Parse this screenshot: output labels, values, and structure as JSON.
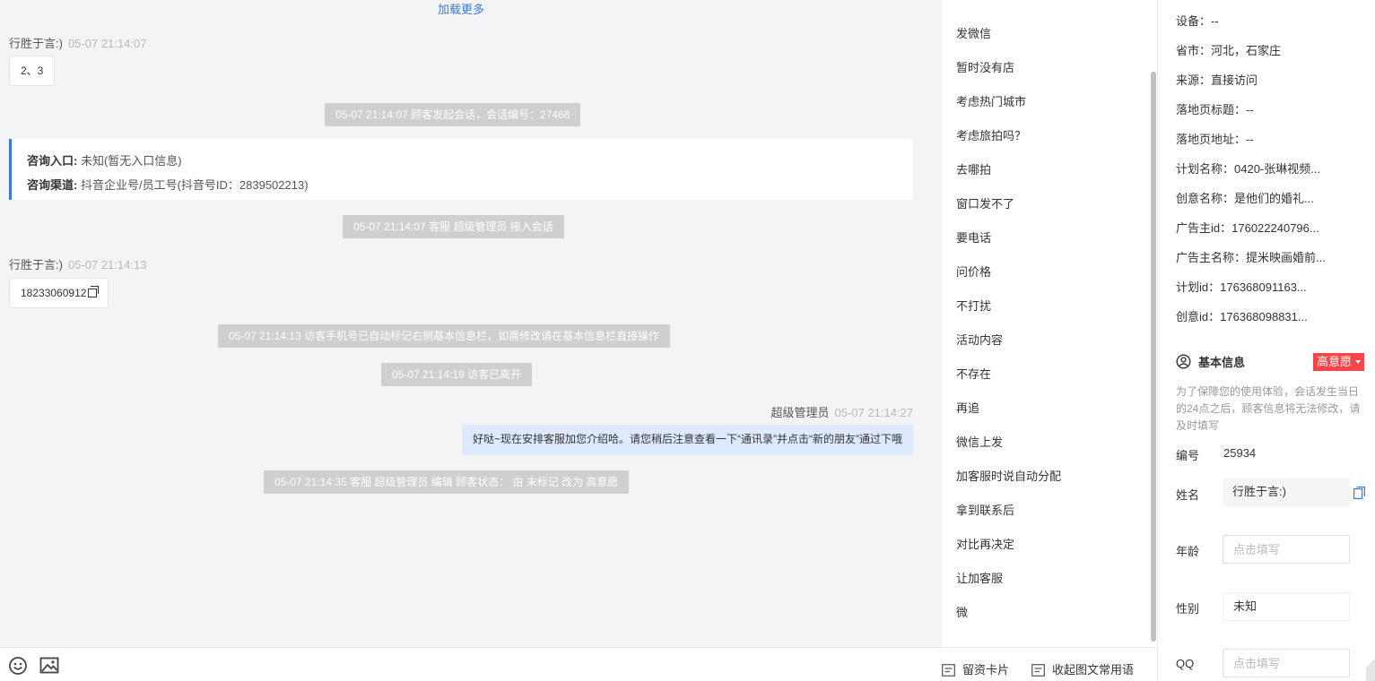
{
  "chat": {
    "load_more": "加载更多",
    "messages": [
      {
        "sender": "行胜于言:)",
        "time": "05-07 21:14:07",
        "text": "2、3"
      },
      {
        "system": "05-07 21:14:07 顾客发起会话，会话编号：27468"
      },
      {
        "consult_entry_label": "咨询入口:",
        "consult_entry_value": "未知(暂无入口信息)",
        "consult_channel_label": "咨询渠道:",
        "consult_channel_value": "抖音企业号/员工号(抖音号ID：2839502213)"
      },
      {
        "system": "05-07 21:14:07 客服 超级管理员 接入会话"
      },
      {
        "sender": "行胜于言:)",
        "time": "05-07 21:14:13",
        "text": "18233060912"
      },
      {
        "system": "05-07 21:14:13 访客手机号已自动标记右侧基本信息栏，如需修改请在基本信息栏直接操作"
      },
      {
        "system": "05-07 21:14:19 访客已离开"
      },
      {
        "sender": "超级管理员",
        "time": "05-07 21:14:27",
        "text": "好哒~现在安排客服加您介绍哈。请您稍后注意查看一下“通讯录”并点击“新的朋友”通过下哦"
      },
      {
        "system": "05-07 21:14:35 客服 超级管理员 编辑 顾客状态： 由 未标记 改为 高意愿"
      }
    ]
  },
  "quick_replies": {
    "items": [
      "发微信",
      "暂时没有店",
      "考虑热门城市",
      "考虑旅拍吗？",
      "去哪拍",
      "窗口发不了",
      "要电话",
      "问价格",
      "不打扰",
      "活动内容",
      "不存在",
      "再追",
      "微信上发",
      "加客服时说自动分配",
      "拿到联系后",
      "对比再决定",
      "让加客服",
      "微"
    ]
  },
  "bottom_bar": {
    "emoji_icon": "smile-icon",
    "image_icon": "image-icon",
    "card_label": "留资卡片",
    "collapse_label": "收起图文常用语"
  },
  "info_panel": {
    "visitor_meta": [
      {
        "label": "设备：",
        "value": "--"
      },
      {
        "label": "省市：",
        "value": "河北，石家庄"
      },
      {
        "label": "来源：",
        "value": "直接访问"
      },
      {
        "label": "落地页标题：",
        "value": "--"
      },
      {
        "label": "落地页地址：",
        "value": "--"
      },
      {
        "label": "计划名称：",
        "value": "0420-张琳视频..."
      },
      {
        "label": "创意名称：",
        "value": "是他们的婚礼..."
      },
      {
        "label": "广告主id：",
        "value": "176022240796..."
      },
      {
        "label": "广告主名称：",
        "value": "提米映画婚前..."
      },
      {
        "label": "计划id：",
        "value": "176368091163..."
      },
      {
        "label": "创意id：",
        "value": "176368098831..."
      }
    ],
    "basic_info_title": "基本信息",
    "intent_badge": "高意愿",
    "intent_color": "#f5454b",
    "notice": "为了保障您的使用体验，会话发生当日的24点之后，顾客信息将无法修改，请及时填写",
    "fields": {
      "id_label": "编号",
      "id_value": "25934",
      "name_label": "姓名",
      "name_value": "行胜于言:)",
      "age_label": "年龄",
      "age_placeholder": "点击填写",
      "gender_label": "性别",
      "gender_value": "未知",
      "qq_label": "QQ",
      "qq_placeholder": "点击填写"
    }
  },
  "colors": {
    "accent": "#3a7bd5",
    "chat_bg": "#f3f4f6",
    "system_bg": "#cfcfcf",
    "agent_bubble": "#dde9fc"
  }
}
